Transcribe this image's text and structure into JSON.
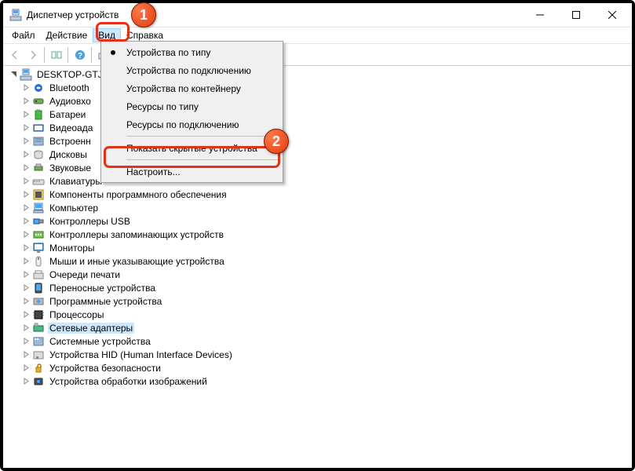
{
  "window": {
    "title": "Диспетчер устройств"
  },
  "menubar": {
    "file": "Файл",
    "action": "Действие",
    "view": "Вид",
    "help": "Справка"
  },
  "dropdown": {
    "by_type": "Устройства по типу",
    "by_connection": "Устройства по подключению",
    "by_container": "Устройства по контейнеру",
    "res_by_type": "Ресурсы по типу",
    "res_by_conn": "Ресурсы по подключению",
    "show_hidden": "Показать скрытые устройства",
    "customize": "Настроить..."
  },
  "tree": {
    "root": "DESKTOP-GTJ",
    "items": [
      "Bluetooth",
      "Аудиовхо",
      "Батареи",
      "Видеоада",
      "Встроенн",
      "Дисковы",
      "Звуковые",
      "Клавиатуры",
      "Компоненты программного обеспечения",
      "Компьютер",
      "Контроллеры USB",
      "Контроллеры запоминающих устройств",
      "Мониторы",
      "Мыши и иные указывающие устройства",
      "Очереди печати",
      "Переносные устройства",
      "Программные устройства",
      "Процессоры",
      "Сетевые адаптеры",
      "Системные устройства",
      "Устройства HID (Human Interface Devices)",
      "Устройства безопасности",
      "Устройства обработки изображений"
    ],
    "selected_index": 18
  },
  "callouts": {
    "c1": "1",
    "c2": "2"
  }
}
